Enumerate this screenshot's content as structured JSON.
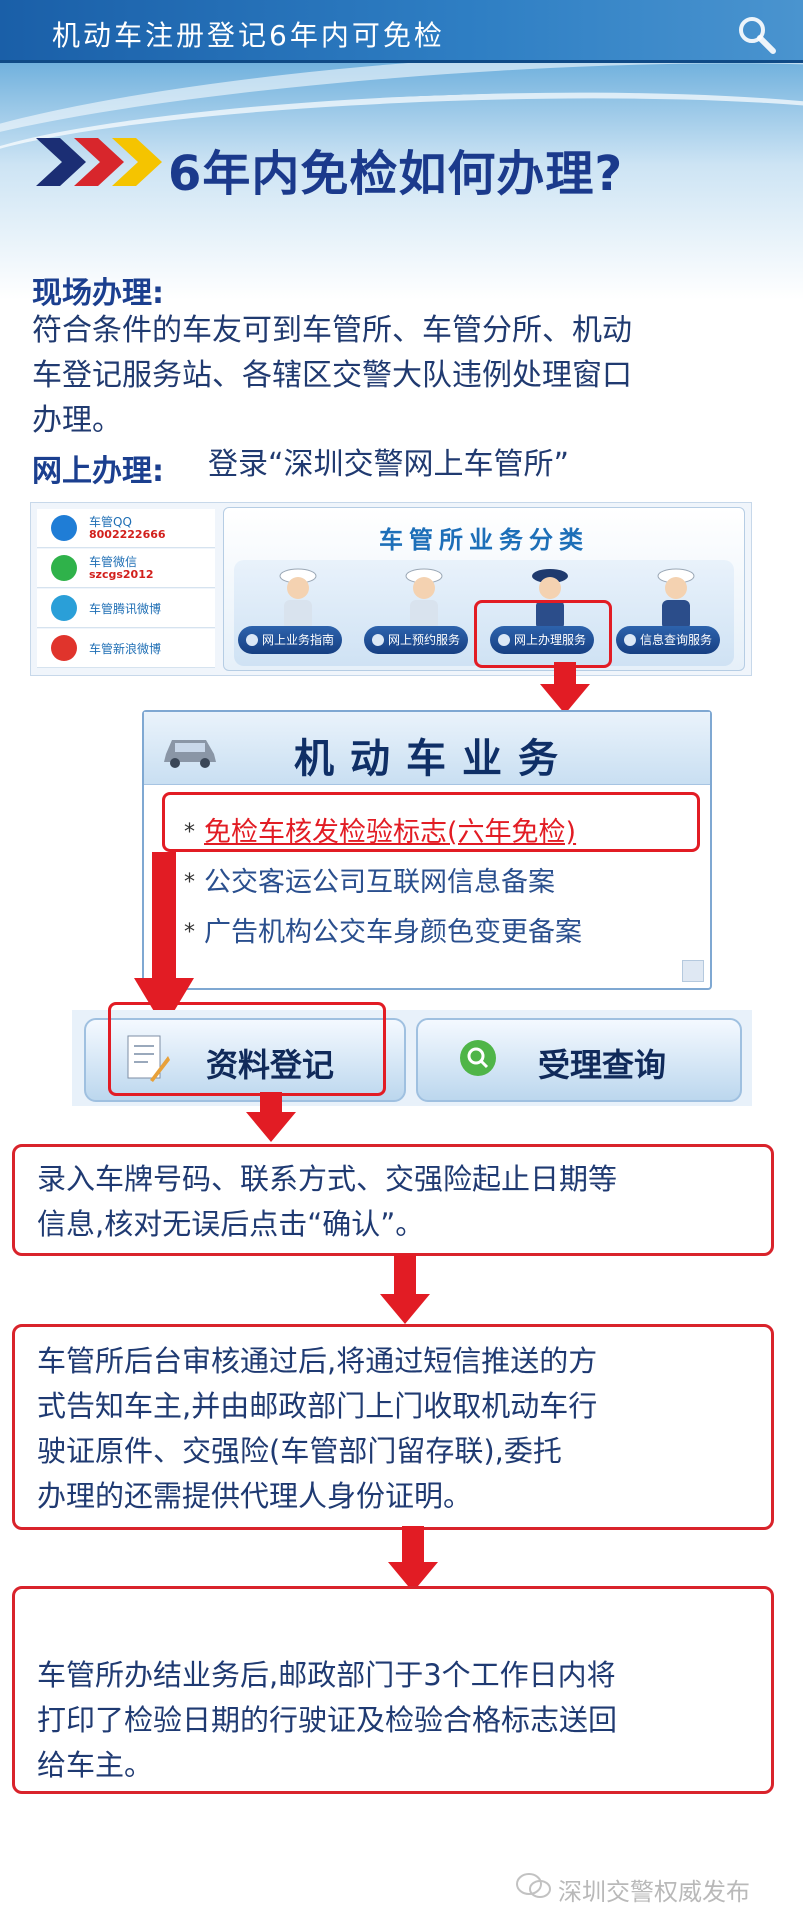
{
  "header": {
    "title": "机动车注册登记6年内可免检",
    "search_icon": "search-icon"
  },
  "headline": {
    "question": "6年内免检如何办理?"
  },
  "onsite": {
    "label": "现场办理:",
    "lines": [
      "符合条件的车友可到车管所、车管分所、机动",
      "车登记服务站、各辖区交警大队违例处理窗口",
      "办理。"
    ]
  },
  "online": {
    "label": "网上办理:",
    "text": "登录“深圳交警网上车管所”"
  },
  "site": {
    "sidebar": [
      {
        "label": "车管QQ",
        "sub": "8002222666",
        "icon": "qq-icon",
        "color": "#1f7dd6"
      },
      {
        "label": "车管微信",
        "sub": "szcgs2012",
        "icon": "wechat-icon",
        "color": "#2fb24a"
      },
      {
        "label": "车管腾讯微博",
        "sub": "",
        "icon": "tencent-weibo-icon",
        "color": "#2a9fd8"
      },
      {
        "label": "车管新浪微博",
        "sub": "",
        "icon": "sina-weibo-icon",
        "color": "#e0342c"
      }
    ],
    "category_title": "车管所业务分类",
    "services": [
      "网上业务指南",
      "网上预约服务",
      "网上办理服务",
      "信息查询服务"
    ]
  },
  "motor": {
    "title": "机动车业务",
    "items": [
      "免检车核发检验标志(六年免检)",
      "公交客运公司互联网信息备案",
      "广告机构公交车身颜色变更备案"
    ]
  },
  "buttons": {
    "register": "资料登记",
    "query": "受理查询"
  },
  "steps": [
    {
      "lines": [
        "录入车牌号码、联系方式、交强险起止日期等",
        "信息,核对无误后点击“确认”。"
      ]
    },
    {
      "lines": [
        "车管所后台审核通过后,将通过短信推送的方",
        "式告知车主,并由邮政部门上门收取机动车行",
        "驶证原件、交强险(车管部门留存联),委托",
        "办理的还需提供代理人身份证明。"
      ]
    },
    {
      "lines": [
        "车管所办结业务后,邮政部门于3个工作日内将",
        "打印了检验日期的行驶证及检验合格标志送回",
        "给车主。"
      ]
    }
  ],
  "footer": {
    "text": "深圳交警权威发布"
  }
}
